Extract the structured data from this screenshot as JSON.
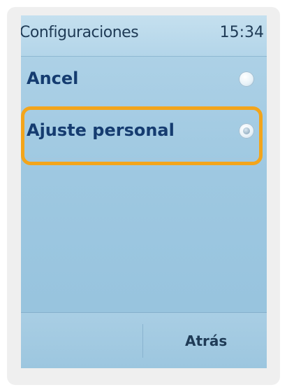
{
  "header": {
    "title": "Configuraciones",
    "time": "15:34"
  },
  "options": [
    {
      "label": "Ancel",
      "selected": false
    },
    {
      "label": "Ajuste personal",
      "selected": true
    }
  ],
  "softkeys": {
    "left": "",
    "right": "Atrás"
  },
  "colors": {
    "highlight": "#f3a51b",
    "label_text": "#153c70",
    "screen_background": "#9ec8e1"
  }
}
